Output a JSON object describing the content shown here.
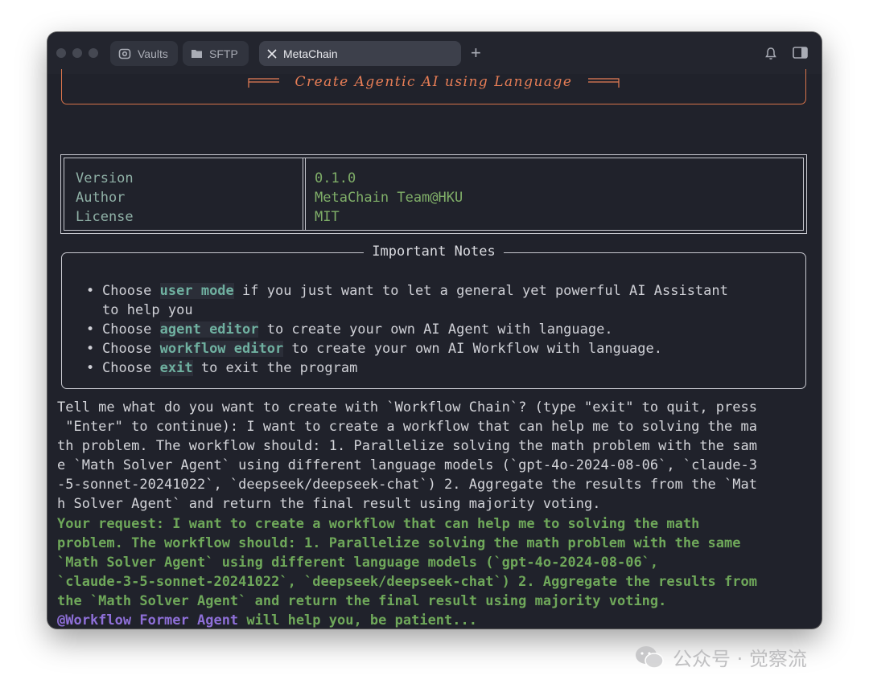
{
  "tabs": [
    {
      "label": "Vaults",
      "icon": "vault-icon"
    },
    {
      "label": "SFTP",
      "icon": "folder-icon"
    },
    {
      "label": "MetaChain",
      "icon": "close-icon",
      "active": true
    }
  ],
  "new_tab_label": "+",
  "banner": {
    "title": "Create Agentic AI using Language"
  },
  "info": {
    "keys": [
      "Version",
      "Author",
      "License"
    ],
    "values": [
      "0.1.0",
      "MetaChain Team@HKU",
      "MIT"
    ]
  },
  "notes": {
    "title": "Important Notes",
    "items": [
      {
        "pre": "Choose ",
        "kw": "user mode",
        "post": " if you just want to let a general yet powerful AI Assistant",
        "post2": "to help you"
      },
      {
        "pre": "Choose ",
        "kw": "agent editor",
        "post": " to create your own AI Agent with language."
      },
      {
        "pre": "Choose ",
        "kw": "workflow editor",
        "post": " to create your own AI Workflow with language."
      },
      {
        "pre": "Choose ",
        "kw": "exit",
        "post": " to exit the program"
      }
    ]
  },
  "prompt_lines": [
    "Tell me what do you want to create with `Workflow Chain`? (type \"exit\" to quit, press",
    " \"Enter\" to continue): I want to create a workflow that can help me to solving the ma",
    "th problem. The workflow should: 1. Parallelize solving the math problem with the sam",
    "e `Math Solver Agent` using different language models (`gpt-4o-2024-08-06`, `claude-3",
    "-5-sonnet-20241022`, `deepseek/deepseek-chat`) 2. Aggregate the results from the `Mat",
    "h Solver Agent` and return the final result using majority voting."
  ],
  "request_lines": [
    "Your request: I want to create a workflow that can help me to solving the math",
    "problem. The workflow should: 1. Parallelize solving the math problem with the same",
    "`Math Solver Agent` using different language models (`gpt-4o-2024-08-06`,",
    "`claude-3-5-sonnet-20241022`, `deepseek/deepseek-chat`) 2. Aggregate the results from",
    "the `Math Solver Agent` and return the final result using majority voting."
  ],
  "agent_line": {
    "agent": "@Workflow Former Agent",
    "rest": " will help you, be patient..."
  },
  "watermark": "公众号 · 觉察流",
  "colors": {
    "accent_orange": "#e87e56",
    "green": "#6fa85a",
    "purple": "#8e6fd8",
    "teal": "#6fb0a0",
    "background": "#20222b"
  }
}
